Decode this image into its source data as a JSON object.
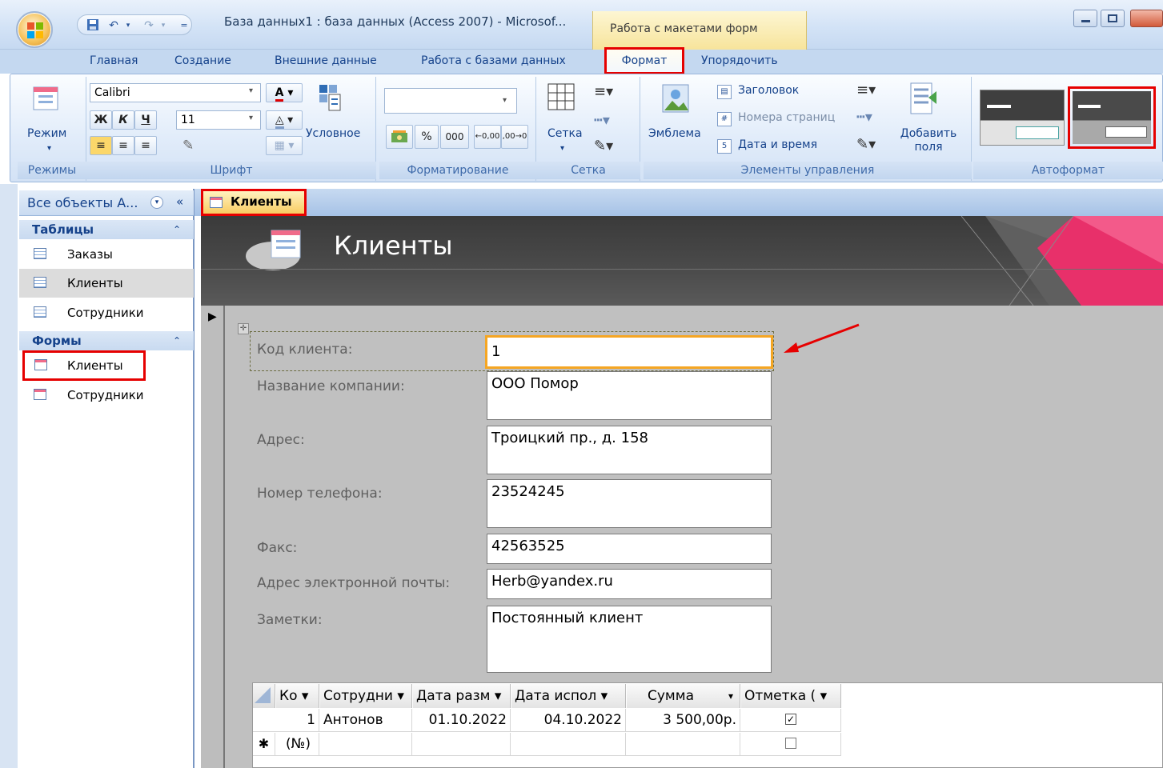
{
  "window": {
    "title": "База данных1 : база данных (Access 2007) - Microsof...",
    "context_tab_label": "Работа с макетами форм"
  },
  "ribbon_tabs": [
    "Главная",
    "Создание",
    "Внешние данные",
    "Работа с базами данных",
    "Формат",
    "Упорядочить"
  ],
  "ribbon": {
    "views": {
      "button": "Режим",
      "group": "Режимы"
    },
    "font": {
      "group": "Шрифт",
      "font_name": "Calibri",
      "font_size": "11",
      "bold": "Ж",
      "italic": "К",
      "underline": "Ч",
      "conditional": "Условное"
    },
    "formatting": {
      "group": "Форматирование",
      "percent": "%",
      "thousands": "000",
      "dec_up": "←,0 ,00",
      "dec_down": ",00 →,0"
    },
    "gridlines": {
      "button": "Сетка",
      "group": "Сетка"
    },
    "controls": {
      "group": "Элементы управления",
      "logo": "Эмблема",
      "title": "Заголовок",
      "page_numbers": "Номера страниц",
      "date_time": "Дата и время",
      "add_fields": "Добавить поля"
    },
    "autoformat": {
      "group": "Автоформат"
    }
  },
  "nav": {
    "header": "Все объекты А...",
    "sections": [
      {
        "title": "Таблицы",
        "items": [
          "Заказы",
          "Клиенты",
          "Сотрудники"
        ]
      },
      {
        "title": "Формы",
        "items": [
          "Клиенты",
          "Сотрудники"
        ]
      }
    ]
  },
  "document": {
    "tab": "Клиенты",
    "form_title": "Клиенты",
    "fields": [
      {
        "label": "Код клиента:",
        "value": "1"
      },
      {
        "label": "Название компании:",
        "value": "ООО Помор"
      },
      {
        "label": "Адрес:",
        "value": "Троицкий пр., д. 158"
      },
      {
        "label": "Номер телефона:",
        "value": "23524245"
      },
      {
        "label": "Факс:",
        "value": "42563525"
      },
      {
        "label": "Адрес электронной почты:",
        "value": "Herb@yandex.ru"
      },
      {
        "label": "Заметки:",
        "value": "Постоянный клиент"
      }
    ],
    "subform": {
      "columns": [
        "Ко ▾",
        "Сотрудни ▾",
        "Дата разм ▾",
        "Дата испол ▾",
        "Сумма",
        "Отметка ( ▾"
      ],
      "rows": [
        {
          "id": "1",
          "employee": "Антонов",
          "date_placed": "01.10.2022",
          "date_done": "04.10.2022",
          "sum": "3 500,00р.",
          "checked": true
        }
      ],
      "new_row": {
        "marker": "✱",
        "id": "(№)"
      }
    }
  },
  "colors": {
    "highlight_red": "#e60000",
    "focus_orange": "#f5a623",
    "ribbon_text": "#15428b"
  }
}
